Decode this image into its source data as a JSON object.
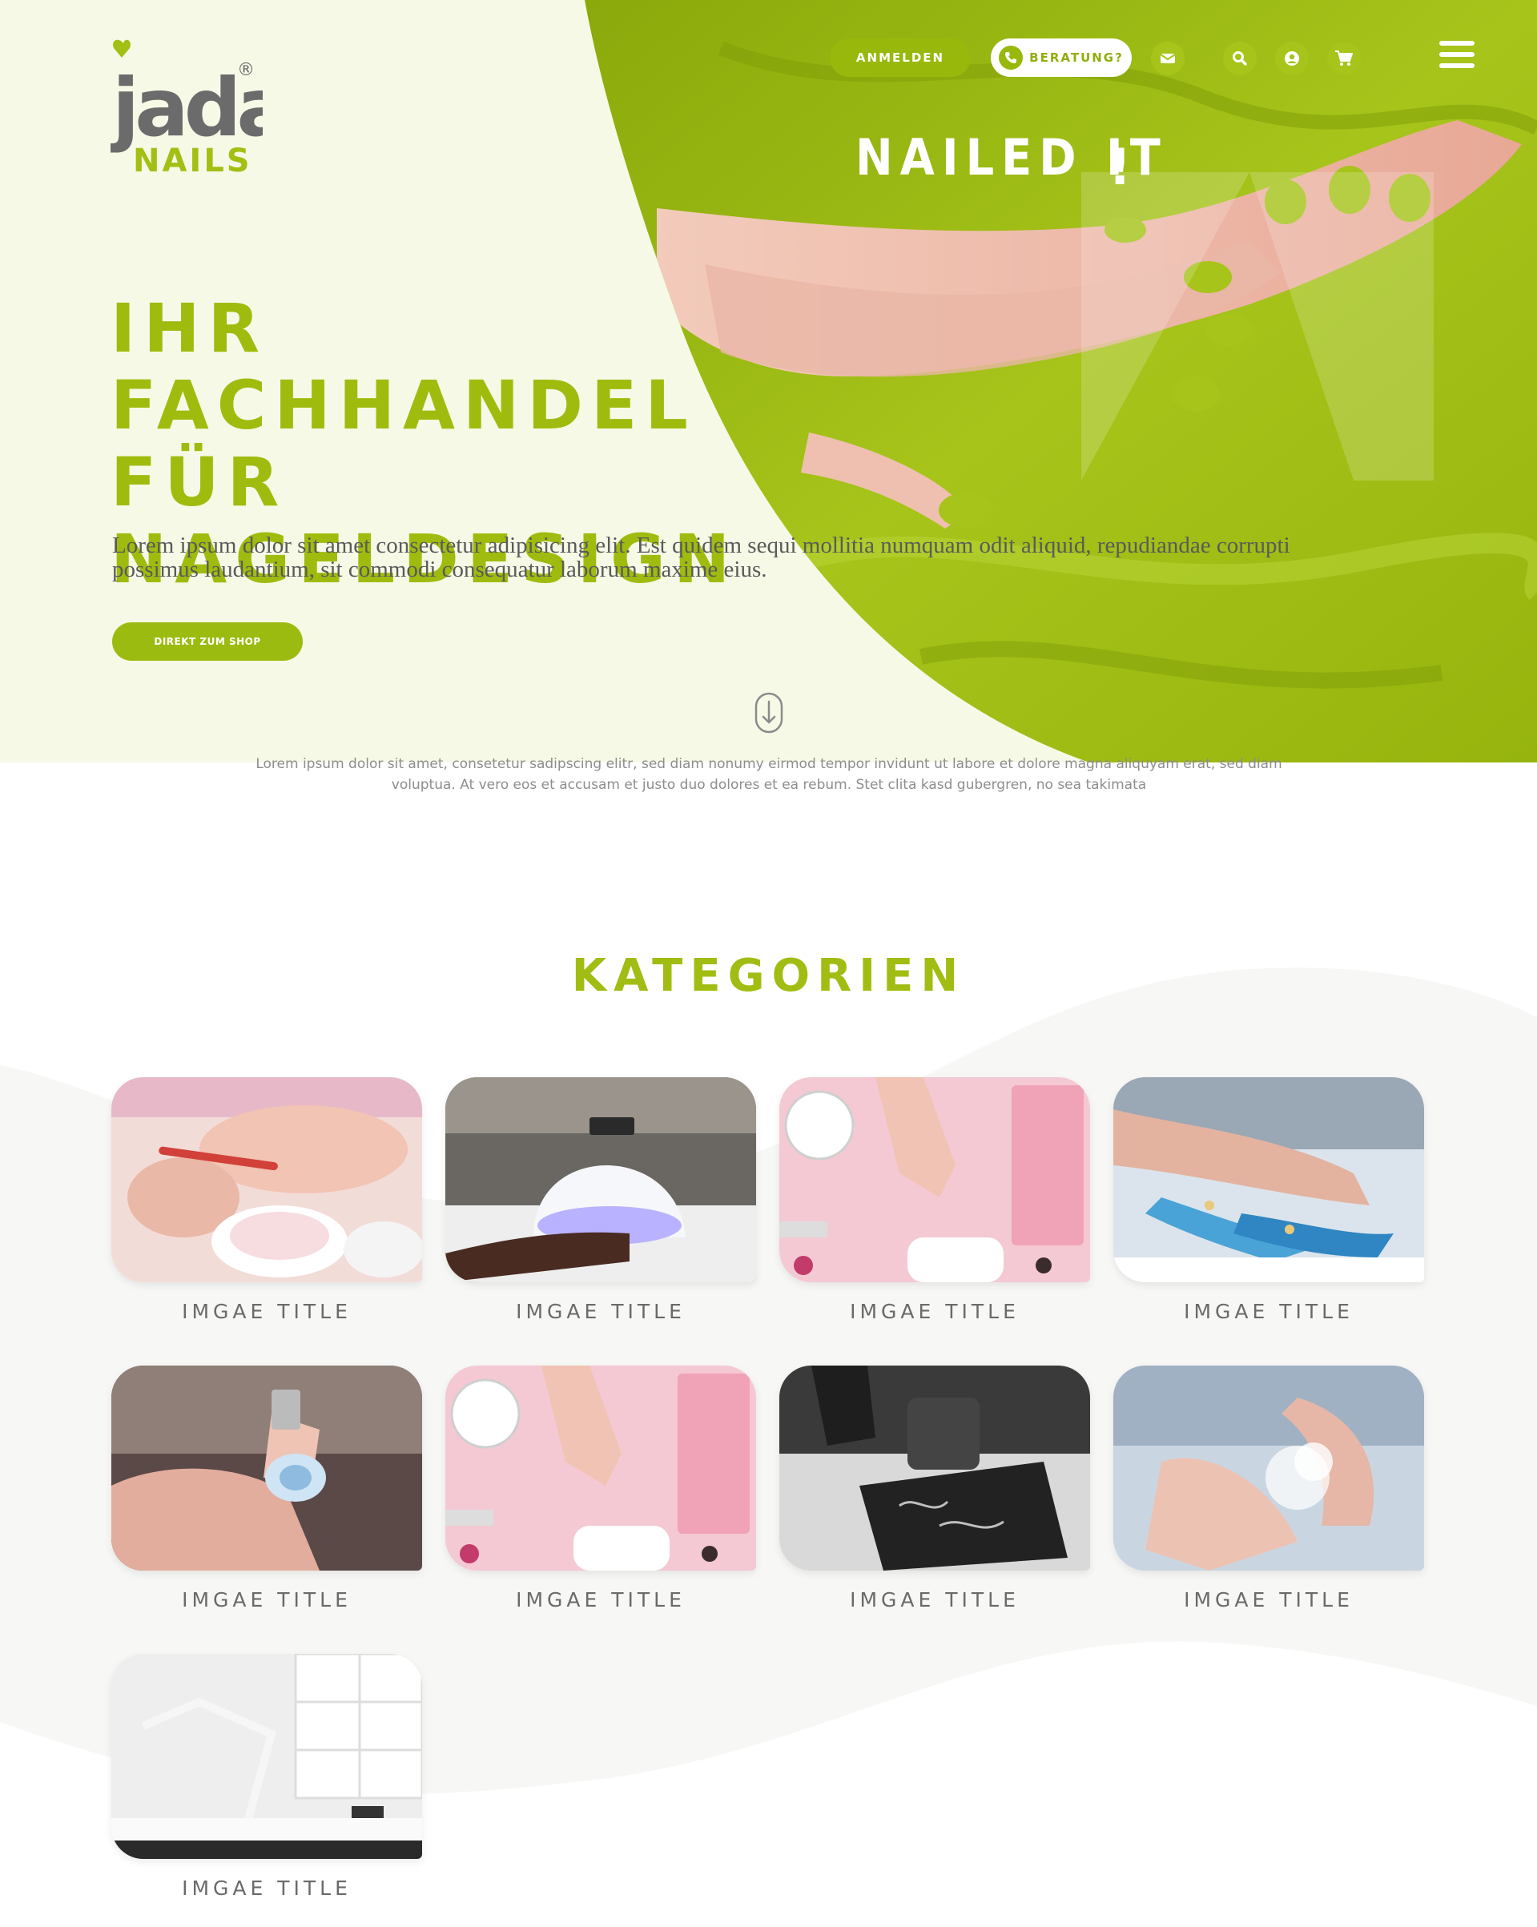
{
  "nav": {
    "login_label": "ANMELDEN",
    "advice_label": "BERATUNG?",
    "icons": [
      "mail-icon",
      "search-icon",
      "user-icon",
      "cart-icon",
      "menu-icon"
    ]
  },
  "logo": {
    "word": "jada",
    "sub": "NAILS",
    "mark": "®"
  },
  "hero": {
    "tagline": "NAILED IT",
    "headline_lines": [
      "IHR FACHHANDEL",
      "FÜR",
      "NAGELDESIGN"
    ],
    "lead": "Lorem ipsum dolor sit amet consectetur adipisicing elit. Est quidem sequi mollitia numquam odit aliquid, repudiandae corrupti possimus laudantium, sit commodi consequatur laborum maxime eius.",
    "cta_label": "DIREKT ZUM SHOP",
    "intro": "Lorem ipsum dolor sit amet, consetetur sadipscing elitr, sed diam nonumy eirmod tempor invidunt ut labore et dolore magna aliquyam erat, sed diam voluptua. At vero eos et accusam et justo duo dolores et ea rebum. Stet clita kasd gubergren, no sea takimata"
  },
  "categories": {
    "heading": "KATEGORIEN",
    "items": [
      {
        "title": "IMGAE TITLE"
      },
      {
        "title": "IMGAE TITLE"
      },
      {
        "title": "IMGAE TITLE"
      },
      {
        "title": "IMGAE TITLE"
      },
      {
        "title": "IMGAE TITLE"
      },
      {
        "title": "IMGAE TITLE"
      },
      {
        "title": "IMGAE TITLE"
      },
      {
        "title": "IMGAE TITLE"
      },
      {
        "title": "IMGAE TITLE"
      }
    ]
  },
  "colors": {
    "accent": "#9fbc0e",
    "hero_bg": "#f6f9e6",
    "green_photo": "#a0be12"
  }
}
